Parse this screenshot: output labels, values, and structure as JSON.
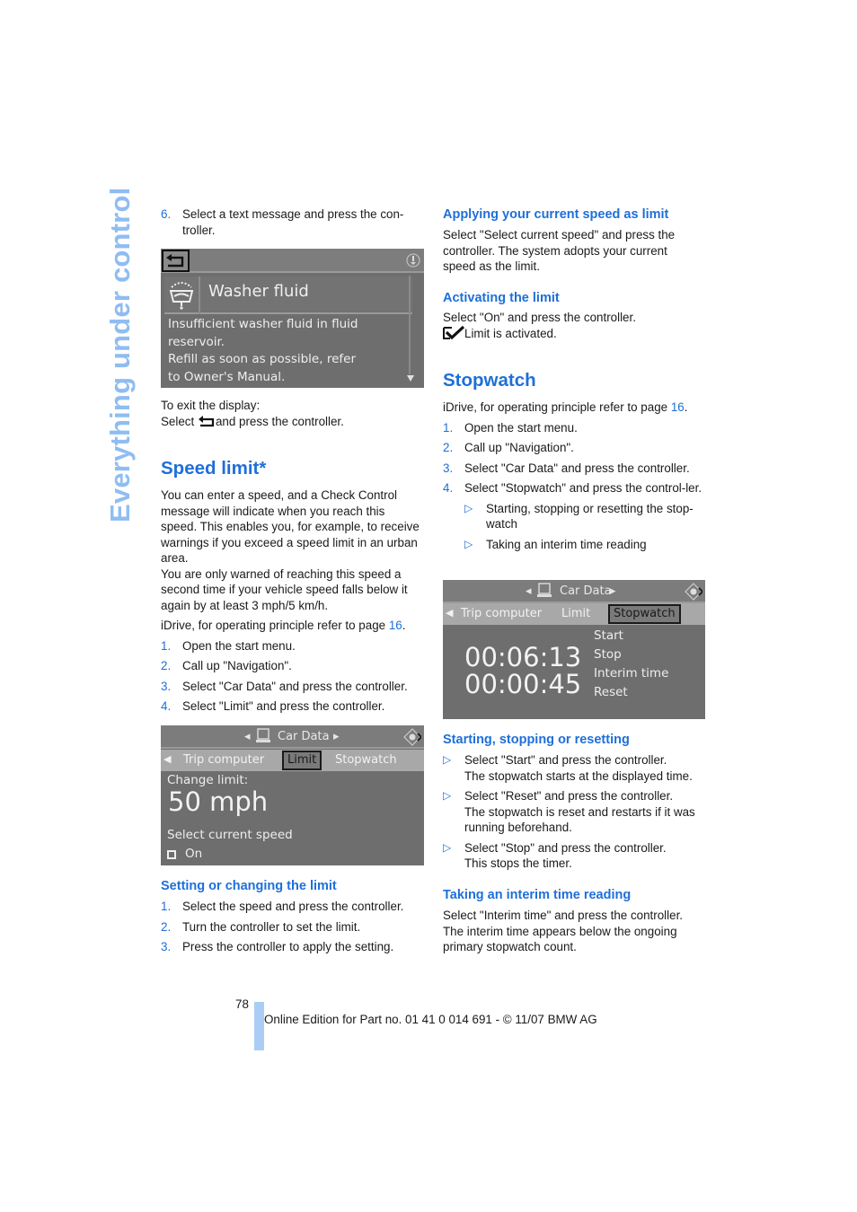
{
  "side_title": "Everything under control",
  "left": {
    "step6_num": "6.",
    "step6_text": "Select a text message and press the con-troller.",
    "washer_screen": {
      "title": "Washer fluid",
      "lines": [
        "Insufficient washer fluid in fluid",
        "reservoir.",
        "Refill as soon as possible, refer",
        "to Owner's Manual."
      ]
    },
    "exit_line1": "To exit the display:",
    "exit_line2_pre": "Select",
    "exit_line2_post": "and press the controller.",
    "speed_limit_heading": "Speed limit*",
    "intro_para1": "You can enter a speed, and a Check Control message will indicate when you reach this speed. This enables you, for example, to receive warnings if you exceed a speed limit in an urban area.",
    "intro_para2": "You are only warned of reaching this speed a second time if your vehicle speed falls below it again by at least 3 mph/5 km/h.",
    "idrive_pre": "iDrive, for operating principle refer to page ",
    "idrive_page": "16",
    "idrive_post": ".",
    "steps": [
      {
        "num": "1.",
        "text": "Open the start menu."
      },
      {
        "num": "2.",
        "text": "Call up \"Navigation\"."
      },
      {
        "num": "3.",
        "text": "Select \"Car Data\" and press the controller."
      },
      {
        "num": "4.",
        "text": "Select \"Limit\" and press the controller."
      }
    ],
    "limit_screen": {
      "nav": "Car Data",
      "tabs": [
        "Trip computer",
        "Limit",
        "Stopwatch"
      ],
      "selected_tab": "Limit",
      "change_label": "Change limit:",
      "value": "50 mph",
      "select_current": "Select current speed",
      "on_label": "On"
    },
    "setting_heading": "Setting or changing the limit",
    "setting_steps": [
      {
        "num": "1.",
        "text": "Select the speed and press the controller."
      },
      {
        "num": "2.",
        "text": "Turn the controller to set the limit."
      },
      {
        "num": "3.",
        "text": "Press the controller to apply the setting."
      }
    ]
  },
  "right": {
    "apply_heading": "Applying your current speed as limit",
    "apply_text": "Select \"Select current speed\" and press the controller. The system adopts your current speed as the limit.",
    "activate_heading": "Activating the limit",
    "activate_text": "Select \"On\" and press the controller.",
    "activated_text": "Limit is activated.",
    "stopwatch_heading": "Stopwatch",
    "idrive_pre": "iDrive, for operating principle refer to page ",
    "idrive_page": "16",
    "idrive_post": ".",
    "steps": [
      {
        "num": "1.",
        "text": "Open the start menu."
      },
      {
        "num": "2.",
        "text": "Call up \"Navigation\"."
      },
      {
        "num": "3.",
        "text": "Select \"Car Data\" and press the controller."
      },
      {
        "num": "4.",
        "text": "Select \"Stopwatch\" and press the control-ler."
      }
    ],
    "sub_bullets": [
      "Starting, stopping or resetting the stop-watch",
      "Taking an interim time reading"
    ],
    "stopwatch_screen": {
      "nav": "Car Data",
      "tabs": [
        "Trip computer",
        "Limit",
        "Stopwatch"
      ],
      "selected_tab": "Stopwatch",
      "time_main": "00:06:13",
      "time_interim": "00:00:45",
      "menu": [
        "Start",
        "Stop",
        "Interim time",
        "Reset"
      ]
    },
    "ssr_heading": "Starting, stopping or resetting",
    "ssr_bullets": [
      {
        "line1": "Select \"Start\" and press the controller.",
        "line2": "The stopwatch starts at the displayed time."
      },
      {
        "line1": "Select \"Reset\" and press the controller.",
        "line2": "The stopwatch is reset and restarts if it was running beforehand."
      },
      {
        "line1": "Select \"Stop\" and press the controller.",
        "line2": "This stops the timer."
      }
    ],
    "interim_heading": "Taking an interim time reading",
    "interim_text": "Select \"Interim time\" and press the controller. The interim time appears below the ongoing primary stopwatch count."
  },
  "footer": {
    "page_number": "78",
    "edition": "Online Edition for Part no. 01 41 0 014 691 - © 11/07 BMW AG"
  },
  "icons": {
    "list_number_marker": "blue numeral",
    "bullet": "▷",
    "back_icon": "back-arrow-icon",
    "check_icon": "check-icon"
  },
  "colors": {
    "accent_blue": "#1e6fd9",
    "side_title": "#8fbdf2",
    "footer_bar": "#a9cdf5",
    "screen_bg": "#6e6e6e"
  }
}
